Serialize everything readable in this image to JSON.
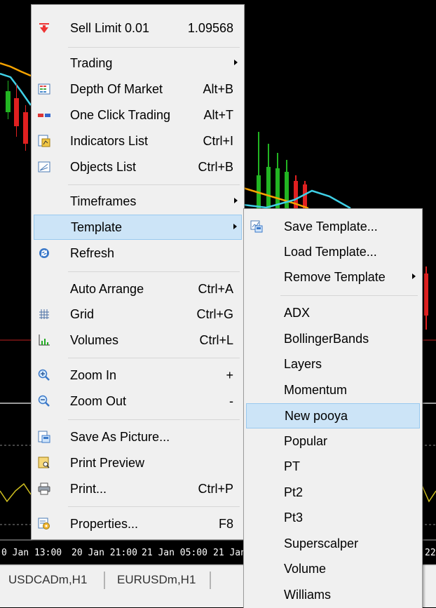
{
  "main_menu": {
    "sell_limit": {
      "label": "Sell Limit 0.01",
      "value": "1.09568",
      "icon": "sell-arrow-icon"
    },
    "trading": {
      "label": "Trading"
    },
    "depth_of_market": {
      "label": "Depth Of Market",
      "shortcut": "Alt+B",
      "icon": "depth-of-market-icon"
    },
    "one_click_trading": {
      "label": "One Click Trading",
      "shortcut": "Alt+T",
      "icon": "one-click-trading-icon"
    },
    "indicators_list": {
      "label": "Indicators List",
      "shortcut": "Ctrl+I",
      "icon": "indicators-list-icon"
    },
    "objects_list": {
      "label": "Objects List",
      "shortcut": "Ctrl+B",
      "icon": "objects-list-icon"
    },
    "timeframes": {
      "label": "Timeframes"
    },
    "template": {
      "label": "Template"
    },
    "refresh": {
      "label": "Refresh",
      "icon": "refresh-icon"
    },
    "auto_arrange": {
      "label": "Auto Arrange",
      "shortcut": "Ctrl+A"
    },
    "grid": {
      "label": "Grid",
      "shortcut": "Ctrl+G",
      "icon": "grid-icon"
    },
    "volumes": {
      "label": "Volumes",
      "shortcut": "Ctrl+L",
      "icon": "volumes-icon"
    },
    "zoom_in": {
      "label": "Zoom In",
      "shortcut": "+",
      "icon": "zoom-in-icon"
    },
    "zoom_out": {
      "label": "Zoom Out",
      "shortcut": "-",
      "icon": "zoom-out-icon"
    },
    "save_as_picture": {
      "label": "Save As Picture...",
      "icon": "save-picture-icon"
    },
    "print_preview": {
      "label": "Print Preview",
      "icon": "print-preview-icon"
    },
    "print": {
      "label": "Print...",
      "shortcut": "Ctrl+P",
      "icon": "printer-icon"
    },
    "properties": {
      "label": "Properties...",
      "shortcut": "F8",
      "icon": "properties-icon"
    }
  },
  "template_menu": {
    "save_template": {
      "label": "Save Template...",
      "icon": "save-template-icon"
    },
    "load_template": {
      "label": "Load Template..."
    },
    "remove_template": {
      "label": "Remove Template"
    },
    "templates": [
      "ADX",
      "BollingerBands",
      "Layers",
      "Momentum",
      "New pooya",
      "Popular",
      "PT",
      "Pt2",
      "Pt3",
      "Superscalper",
      "Volume",
      "Williams"
    ],
    "highlighted": "New pooya"
  },
  "chart": {
    "time_labels": [
      "0 Jan 13:00",
      "20 Jan 21:00",
      "21 Jan 05:00",
      "21 Jan",
      "22"
    ],
    "symbol_tabs": [
      "USDCADm,H1",
      "EURUSDm,H1"
    ]
  },
  "colors": {
    "menu_bg": "#f0f0f0",
    "highlight_bg": "#cce4f7",
    "highlight_border": "#99c9ef",
    "bull_candle": "#22b522",
    "bear_candle": "#e02020",
    "ma_orange": "#f5a300",
    "ma_cyan": "#3fd0e6"
  }
}
